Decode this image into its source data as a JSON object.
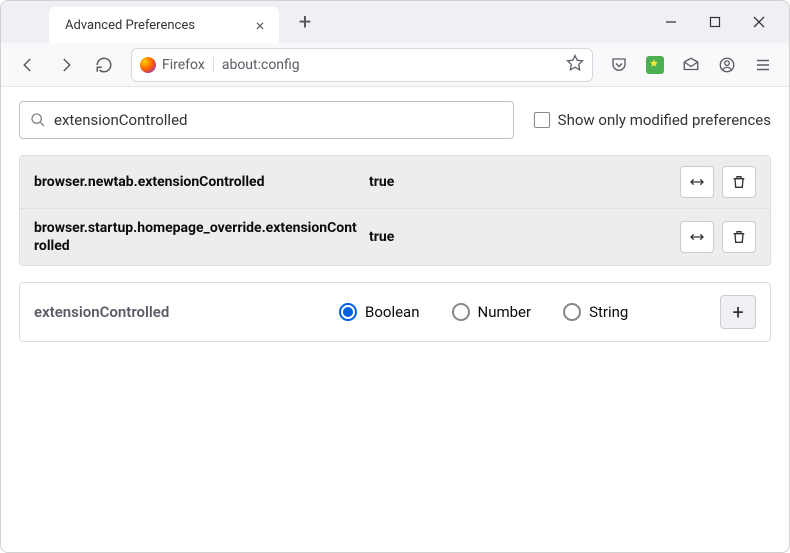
{
  "window": {
    "tab_title": "Advanced Preferences"
  },
  "toolbar": {
    "identity_label": "Firefox",
    "url": "about:config"
  },
  "search": {
    "value": "extensionControlled",
    "filter_label": "Show only modified preferences"
  },
  "prefs": [
    {
      "name": "browser.newtab.extensionControlled",
      "value": "true"
    },
    {
      "name": "browser.startup.homepage_override.extensionControlled",
      "value": "true"
    }
  ],
  "add": {
    "name": "extensionControlled",
    "types": {
      "boolean": "Boolean",
      "number": "Number",
      "string": "String"
    },
    "selected": "boolean"
  }
}
